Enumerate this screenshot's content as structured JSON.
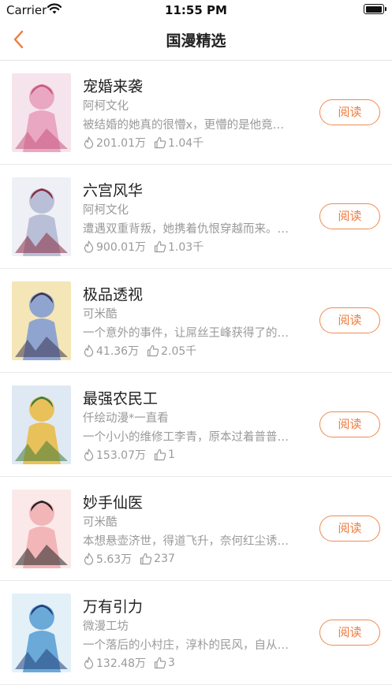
{
  "status_bar": {
    "carrier": "Carrier",
    "time": "11:55 PM"
  },
  "nav": {
    "title": "国漫精选"
  },
  "colors": {
    "accent": "#ef7a3c",
    "meta_gray": "#9a9a9a"
  },
  "items": [
    {
      "title": "宠婚来袭",
      "author": "阿柯文化",
      "desc": "被结婚的她真的很懵x，更懵的是他竟…",
      "heat": "201.01万",
      "likes": "1.04千",
      "read_label": "阅读",
      "cover_colors": [
        "#f6e4ec",
        "#e9a7c2",
        "#c7587d"
      ]
    },
    {
      "title": "六宫风华",
      "author": "阿柯文化",
      "desc": "遭遇双重背叛，她携着仇恨穿越而来。…",
      "heat": "900.01万",
      "likes": "1.03千",
      "read_label": "阅读",
      "cover_colors": [
        "#eef0f6",
        "#b9bfd6",
        "#8a2a3f"
      ]
    },
    {
      "title": "极品透视",
      "author": "可米酷",
      "desc": "一个意外的事件，让屌丝王峰获得了的…",
      "heat": "41.36万",
      "likes": "2.05千",
      "read_label": "阅读",
      "cover_colors": [
        "#f4e6b7",
        "#8fa5cf",
        "#3d3552"
      ]
    },
    {
      "title": "最强农民工",
      "author": "仟绘动漫*一直看",
      "desc": "一个小小的维修工李青，原本过着普普…",
      "heat": "153.07万",
      "likes": "1",
      "read_label": "阅读",
      "cover_colors": [
        "#dfe9f4",
        "#e9c15a",
        "#3f7a3a"
      ]
    },
    {
      "title": "妙手仙医",
      "author": "可米酷",
      "desc": "本想悬壶济世，得道飞升，奈何红尘诱…",
      "heat": "5.63万",
      "likes": "237",
      "read_label": "阅读",
      "cover_colors": [
        "#fbe9ea",
        "#f2b5b8",
        "#222222"
      ]
    },
    {
      "title": "万有引力",
      "author": "微漫工坊",
      "desc": "一个落后的小村庄，淳朴的民风，自从…",
      "heat": "132.48万",
      "likes": "3",
      "read_label": "阅读",
      "cover_colors": [
        "#e3f0f8",
        "#6aa9d8",
        "#1f3f7a"
      ]
    }
  ]
}
